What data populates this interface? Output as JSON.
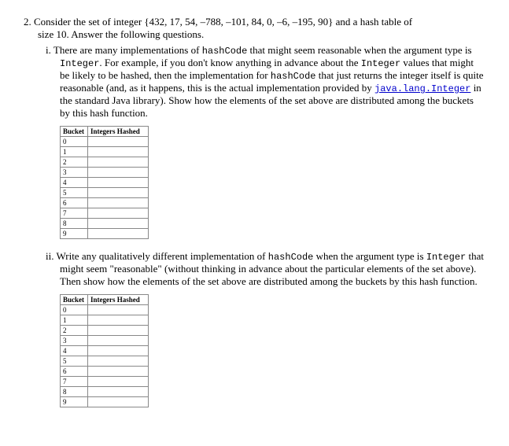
{
  "question": {
    "number": "2.",
    "text_line1": "Consider the set of integer {432, 17, 54, –788, –101, 84, 0, –6, –195, 90} and a hash table of",
    "text_line2": "size 10. Answer the following questions."
  },
  "parts": {
    "i": {
      "label": "i.",
      "body": "There are many implementations of ",
      "code1": "hashCode",
      "body2": " that might seem reasonable when the argument type is ",
      "code2": "Integer",
      "body3": ". For example, if you don't know anything in advance about the ",
      "code3": "Integer",
      "body4": " values that might be likely to be hashed, then the implementation for ",
      "code4": "hashCode",
      "body5": " that just returns the integer itself is quite reasonable (and, as it happens, this is the actual implementation provided by ",
      "code5": "java.lang.Integer",
      "body6": " in the standard Java library). Show how the elements of the set above are distributed among the buckets by this hash function."
    },
    "ii": {
      "label": "ii.",
      "body": "Write any qualitatively different implementation of ",
      "code1": "hashCode",
      "body2": " when the argument type is ",
      "code2": "Integer",
      "body3": " that might seem \"reasonable\" (without thinking in advance about the particular elements of the set above). Then show how the elements of the set above are distributed among the buckets by this hash function."
    }
  },
  "table": {
    "header_bucket": "Bucket",
    "header_hashed": "Integers Hashed",
    "rows": [
      "0",
      "1",
      "2",
      "3",
      "4",
      "5",
      "6",
      "7",
      "8",
      "9"
    ]
  }
}
